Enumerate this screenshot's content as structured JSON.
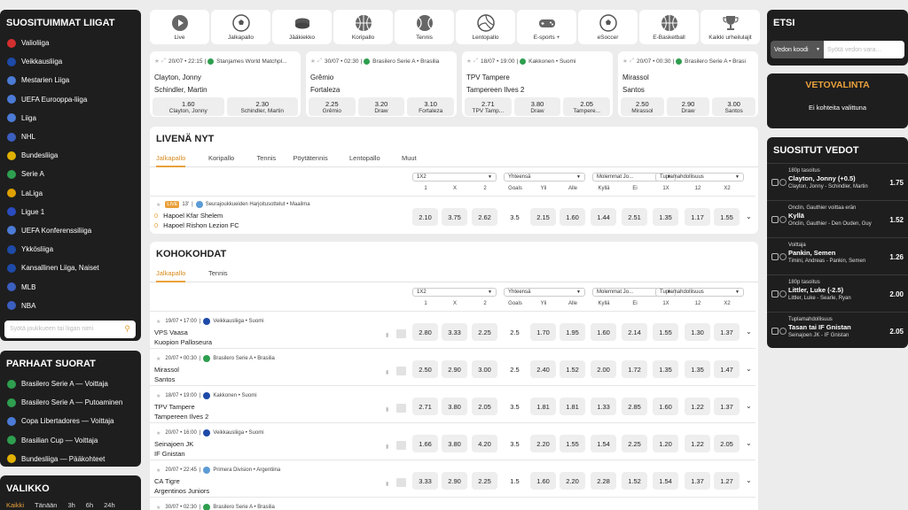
{
  "left": {
    "top_leagues_title": "SUOSITUIMMAT LIIGAT",
    "leagues": [
      {
        "label": "Valioliiga",
        "color": "#d32f2f"
      },
      {
        "label": "Veikkausliiga",
        "color": "#1e4aa8"
      },
      {
        "label": "Mestarien Liiga",
        "color": "#4b7bd6"
      },
      {
        "label": "UEFA Eurooppa-liiga",
        "color": "#4b7bd6"
      },
      {
        "label": "Liiga",
        "color": "#4b7bd6"
      },
      {
        "label": "NHL",
        "color": "#3b5fbf"
      },
      {
        "label": "Bundesliiga",
        "color": "#e0b000"
      },
      {
        "label": "Serie A",
        "color": "#2e9e4f"
      },
      {
        "label": "LaLiga",
        "color": "#e0a000"
      },
      {
        "label": "Ligue 1",
        "color": "#2b4cc0"
      },
      {
        "label": "UEFA Konferenssiliiga",
        "color": "#4b7bd6"
      },
      {
        "label": "Ykkösliiga",
        "color": "#1e4aa8"
      },
      {
        "label": "Kansallinen Liiga, Naiset",
        "color": "#1e4aa8"
      },
      {
        "label": "MLB",
        "color": "#3b5fbf"
      },
      {
        "label": "NBA",
        "color": "#3b5fbf"
      }
    ],
    "league_search_placeholder": "Syötä joukkueen tai liigan nimi",
    "best_title": "PARHAAT SUORAT",
    "best": [
      {
        "label": "Brasilero Serie A — Voittaja",
        "color": "#2e9e4f"
      },
      {
        "label": "Brasilero Serie A — Putoaminen",
        "color": "#2e9e4f"
      },
      {
        "label": "Copa Libertadores — Voittaja",
        "color": "#4b7bd6"
      },
      {
        "label": "Brasilian Cup — Voittaja",
        "color": "#2e9e4f"
      },
      {
        "label": "Bundesliiga — Pääkohteet",
        "color": "#e0b000"
      }
    ],
    "menu_title": "VALIKKO",
    "menu_tabs": [
      "Kaikki",
      "Tänään",
      "3h",
      "6h",
      "24h"
    ]
  },
  "sports": [
    {
      "label": "Live",
      "icon": "play-icon"
    },
    {
      "label": "Jalkapallo",
      "icon": "football-icon"
    },
    {
      "label": "Jääkiekko",
      "icon": "hockey-puck-icon"
    },
    {
      "label": "Koripallo",
      "icon": "basketball-icon"
    },
    {
      "label": "Tennis",
      "icon": "tennis-ball-icon"
    },
    {
      "label": "Lentopallo",
      "icon": "volleyball-icon"
    },
    {
      "label": "E-sports +",
      "icon": "gamepad-icon"
    },
    {
      "label": "eSoccer",
      "icon": "football-icon"
    },
    {
      "label": "E-Basketball",
      "icon": "basketball-icon"
    },
    {
      "label": "Kaikki urheilulajit",
      "icon": "trophy-icon"
    }
  ],
  "featured": [
    {
      "date": "20/07 • 22:15",
      "league": "Stanjames World Matchpl...",
      "t1": "Clayton, Jonny",
      "t2": "Schindler, Martin",
      "odds": [
        {
          "v": "1.60",
          "l": "Clayton, Jonny"
        },
        {
          "v": "2.30",
          "l": "Schindler, Martin"
        }
      ]
    },
    {
      "date": "30/07 • 02:30",
      "league": "Brasilero Serie A • Brasilia",
      "t1": "Grêmio",
      "t2": "Fortaleza",
      "odds": [
        {
          "v": "2.25",
          "l": "Grêmio"
        },
        {
          "v": "3.20",
          "l": "Draw"
        },
        {
          "v": "3.10",
          "l": "Fortaleza"
        }
      ]
    },
    {
      "date": "18/07 • 19:00",
      "league": "Kakkonen • Suomi",
      "t1": "TPV Tampere",
      "t2": "Tampereen Ilves 2",
      "odds": [
        {
          "v": "2.71",
          "l": "TPV Tamp..."
        },
        {
          "v": "3.80",
          "l": "Draw"
        },
        {
          "v": "2.05",
          "l": "Tampere..."
        }
      ]
    },
    {
      "date": "20/07 • 00:30",
      "league": "Brasilero Serie A • Brasi",
      "t1": "Mirassol",
      "t2": "Santos",
      "odds": [
        {
          "v": "2.50",
          "l": "Mirassol"
        },
        {
          "v": "2.90",
          "l": "Draw"
        },
        {
          "v": "3.00",
          "l": "Santos"
        }
      ]
    }
  ],
  "live": {
    "title": "LIVENÄ NYT",
    "tabs": [
      "Jalkapallo",
      "Koripallo",
      "Tennis",
      "Pöytätennis",
      "Lentopallo",
      "Muut"
    ],
    "live_badge": "LIVE",
    "minute": "13'",
    "league": "Seurajoukkueiden Harjoitusottelut • Maailma",
    "score1": "0",
    "score2": "0",
    "t1": "Hapoel Kfar Shelem",
    "t2": "Hapoel Rishon Lezion FC",
    "odds": [
      "2.10",
      "3.75",
      "2.62",
      "3.5",
      "2.15",
      "1.60",
      "1.44",
      "2.51",
      "1.35",
      "1.17",
      "1.55"
    ]
  },
  "markets": {
    "sel": [
      "1X2",
      "Yhteensä",
      "Molemmat Jo...",
      "Tuplamahdollisuus"
    ],
    "cols": [
      "1",
      "X",
      "2",
      "Goals",
      "Yli",
      "Alle",
      "Kyllä",
      "Ei",
      "1X",
      "12",
      "X2"
    ]
  },
  "high": {
    "title": "KOHOKOHDAT",
    "tabs": [
      "Jalkapallo",
      "Tennis"
    ],
    "rows": [
      {
        "meta": "19/07 • 17:00",
        "league": "Veikkausliiga • Suomi",
        "color": "#1e4aa8",
        "t1": "VPS Vaasa",
        "t2": "Kuopion Palloseura",
        "odds": [
          "2.80",
          "3.33",
          "2.25",
          "2.5",
          "1.70",
          "1.95",
          "1.60",
          "2.14",
          "1.55",
          "1.30",
          "1.37"
        ]
      },
      {
        "meta": "20/07 • 00:30",
        "league": "Brasilero Serie A • Brasilia",
        "color": "#2e9e4f",
        "t1": "Mirassol",
        "t2": "Santos",
        "odds": [
          "2.50",
          "2.90",
          "3.00",
          "2.5",
          "2.40",
          "1.52",
          "2.00",
          "1.72",
          "1.35",
          "1.35",
          "1.47"
        ]
      },
      {
        "meta": "18/07 • 19:00",
        "league": "Kakkonen • Suomi",
        "color": "#1e4aa8",
        "t1": "TPV Tampere",
        "t2": "Tampereen Ilves 2",
        "odds": [
          "2.71",
          "3.80",
          "2.05",
          "3.5",
          "1.81",
          "1.81",
          "1.33",
          "2.85",
          "1.60",
          "1.22",
          "1.37"
        ]
      },
      {
        "meta": "20/07 • 16:00",
        "league": "Veikkausliiga • Suomi",
        "color": "#1e4aa8",
        "t1": "Seinajoen JK",
        "t2": "IF Gnistan",
        "odds": [
          "1.66",
          "3.80",
          "4.20",
          "3.5",
          "2.20",
          "1.55",
          "1.54",
          "2.25",
          "1.20",
          "1.22",
          "2.05"
        ]
      },
      {
        "meta": "20/07 • 22:45",
        "league": "Primera Division • Argentiina",
        "color": "#5b9bd5",
        "t1": "CA Tigre",
        "t2": "Argentinos Juniors",
        "odds": [
          "3.33",
          "2.90",
          "2.25",
          "1.5",
          "1.60",
          "2.20",
          "2.28",
          "1.52",
          "1.54",
          "1.37",
          "1.27"
        ]
      },
      {
        "meta": "30/07 • 02:30",
        "league": "Brasilero Serie A • Brasilia",
        "color": "#2e9e4f",
        "t1": "",
        "t2": "",
        "odds": []
      }
    ]
  },
  "right": {
    "search_title": "ETSI",
    "search_select": "Vedon koodi",
    "search_placeholder": "Syötä vedon vara...",
    "slip_title": "VETOVALINTA",
    "slip_empty": "Ei kohteita valittuna",
    "pop_title": "SUOSITUT VEDOT",
    "pop": [
      {
        "market": "180p tasoitus",
        "sel": "Clayton, Jonny (+0.5)",
        "match": "Clayton, Jonny - Schindler, Martin",
        "odd": "1.75"
      },
      {
        "market": "Onclin, Gauthier voittaa erän",
        "sel": "Kyllä",
        "match": "Onclin, Gauthier - Den Ouden, Guy",
        "odd": "1.52"
      },
      {
        "market": "Voittaja",
        "sel": "Pankin, Semen",
        "match": "Timini, Andreas - Pankin, Semen",
        "odd": "1.26"
      },
      {
        "market": "180p tasoitus",
        "sel": "Littler, Luke (-2.5)",
        "match": "Littler, Luke - Searle, Ryan",
        "odd": "2.00"
      },
      {
        "market": "Tuplamahdollisuus",
        "sel": "Tasan tai IF Gnistan",
        "match": "Seinajoen JK - IF Gnistan",
        "odd": "2.05"
      }
    ]
  }
}
